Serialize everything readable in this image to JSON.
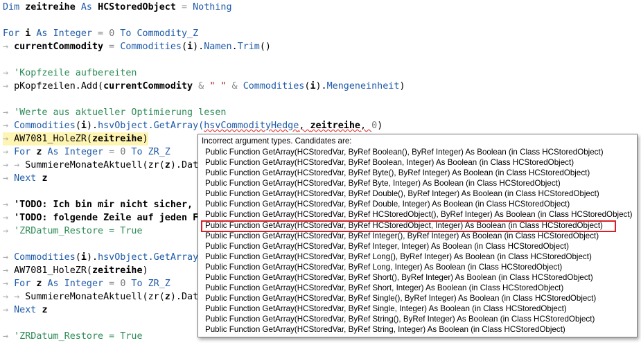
{
  "code": {
    "l1": {
      "a": "Dim ",
      "b": "zeitreihe",
      "c": " As ",
      "d": "HCStoredObject",
      "e": " = ",
      "f": "Nothing"
    },
    "l2": {
      "a": "For ",
      "b": "i",
      "c": " As ",
      "d": "Integer",
      "e": " = ",
      "f": "0",
      "g": " To ",
      "h": "Commodity_Z"
    },
    "l3": {
      "b": "currentCommodity",
      "c": " = ",
      "d": "Commodities",
      "e": "(",
      "f": "i",
      "g": ").",
      "h": "Namen",
      "i": ".",
      "j": "Trim",
      "k": "()"
    },
    "l4": "'Kopfzeile aufbereiten",
    "l5": {
      "a": "pKopfzeilen.Add(",
      "b": "currentCommodity",
      "c": " & ",
      "d": "\" \"",
      "e": " & ",
      "f": "Commodities",
      "g": "(",
      "h": "i",
      "i": ").",
      "j": "Mengeneinheit",
      "k": ")"
    },
    "l6": "'Werte aus aktueller Optimierung lesen",
    "l7": {
      "a": "Commodities",
      "b": "(",
      "c": "i",
      "d": ").",
      "e": "hsvObject",
      "f": ".GetArray(",
      "g": "hsvCommodityHedge",
      "h": ", ",
      "i": "zeitreihe",
      "j": ", ",
      "k": "0",
      "l": ")"
    },
    "l8": {
      "a": "AW7081_HoleZR(",
      "b": "zeitreihe",
      "c": ")"
    },
    "l9": {
      "a": "For ",
      "b": "z",
      "c": " As ",
      "d": "Integer",
      "e": " = ",
      "f": "0",
      "g": " To ",
      "h": "ZR_Z"
    },
    "l10": {
      "a": "SummiereMonateAktuell(zr(",
      "b": "z",
      "c": ").Dat"
    },
    "l11": {
      "a": "Next ",
      "b": "z"
    },
    "l12": "'TODO: Ich bin mir nicht sicher, ",
    "l13": "'TODO: folgende Zeile auf jeden F",
    "l14": "'ZRDatum_Restore = True",
    "l15": {
      "a": "Commodities",
      "b": "(",
      "c": "i",
      "d": ").",
      "e": "hsvObject",
      "f": ".GetArray"
    },
    "l16": {
      "a": "AW7081_HoleZR(",
      "b": "zeitreihe",
      "c": ")"
    },
    "l17": {
      "a": "For ",
      "b": "z",
      "c": " As ",
      "d": "Integer",
      "e": " = ",
      "f": "0",
      "g": " To ",
      "h": "ZR_Z"
    },
    "l18": {
      "a": "SummiereMonateAktuell(zr(",
      "b": "z",
      "c": ").Dat"
    },
    "l19": {
      "a": "Next ",
      "b": "z"
    },
    "l20": "'ZRDatum_Restore = True",
    "arrow": "→"
  },
  "tooltip": {
    "header": "Incorrect argument types. Candidates are:",
    "rows": [
      "Public Function GetArray(HCStoredVar, ByRef Boolean(), ByRef Integer) As Boolean (in Class HCStoredObject)",
      "Public Function GetArray(HCStoredVar, ByRef Boolean, Integer) As Boolean (in Class HCStoredObject)",
      "Public Function GetArray(HCStoredVar, ByRef Byte(), ByRef Integer) As Boolean (in Class HCStoredObject)",
      "Public Function GetArray(HCStoredVar, ByRef Byte, Integer) As Boolean (in Class HCStoredObject)",
      "Public Function GetArray(HCStoredVar, ByRef Double(), ByRef Integer) As Boolean (in Class HCStoredObject)",
      "Public Function GetArray(HCStoredVar, ByRef Double, Integer) As Boolean (in Class HCStoredObject)",
      "Public Function GetArray(HCStoredVar, ByRef HCStoredObject(), ByRef Integer) As Boolean (in Class HCStoredObject)",
      "Public Function GetArray(HCStoredVar, ByRef HCStoredObject, Integer) As Boolean (in Class HCStoredObject)",
      "Public Function GetArray(HCStoredVar, ByRef Integer(), ByRef Integer) As Boolean (in Class HCStoredObject)",
      "Public Function GetArray(HCStoredVar, ByRef Integer, Integer) As Boolean (in Class HCStoredObject)",
      "Public Function GetArray(HCStoredVar, ByRef Long(), ByRef Integer) As Boolean (in Class HCStoredObject)",
      "Public Function GetArray(HCStoredVar, ByRef Long, Integer) As Boolean (in Class HCStoredObject)",
      "Public Function GetArray(HCStoredVar, ByRef Short(), ByRef Integer) As Boolean (in Class HCStoredObject)",
      "Public Function GetArray(HCStoredVar, ByRef Short, Integer) As Boolean (in Class HCStoredObject)",
      "Public Function GetArray(HCStoredVar, ByRef Single(), ByRef Integer) As Boolean (in Class HCStoredObject)",
      "Public Function GetArray(HCStoredVar, ByRef Single, Integer) As Boolean (in Class HCStoredObject)",
      "Public Function GetArray(HCStoredVar, ByRef String(), ByRef Integer) As Boolean (in Class HCStoredObject)",
      "Public Function GetArray(HCStoredVar, ByRef String, Integer) As Boolean (in Class HCStoredObject)"
    ],
    "highlight_index": 7,
    "highlight_color": "#d61f26"
  },
  "colors": {
    "keyword": "#1e5aa8",
    "comment": "#2e8b57",
    "string": "#a31515",
    "current_line": "#fff5b3"
  }
}
